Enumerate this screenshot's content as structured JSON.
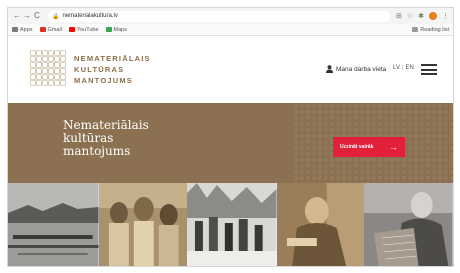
{
  "browser": {
    "url": "nematerialakultura.lv",
    "bookmarks": [
      {
        "label": "Apps",
        "color": "#7a7a7a"
      },
      {
        "label": "Gmail",
        "color": "#d93025"
      },
      {
        "label": "YouTube",
        "color": "#ff0000"
      },
      {
        "label": "Maps",
        "color": "#34a853"
      }
    ],
    "reading_list": "Reading list"
  },
  "header": {
    "logo_lines": [
      "NEMATERIĀLAIS",
      "KULTŪRAS",
      "MANTOJUMS"
    ],
    "account_label": "Mana darba vieta",
    "lang_active": "LV",
    "lang_other": "EN"
  },
  "hero": {
    "title_lines": [
      "Nemateriālais",
      "kultūras",
      "mantojums"
    ],
    "cta_label": "Uzzināt vairāk",
    "cta_arrow": "→",
    "colors": {
      "background": "#8b7151",
      "cta": "#e2203a"
    }
  },
  "photos": [
    {
      "icon": "winter-river-photo"
    },
    {
      "icon": "folk-costume-crowd-photo"
    },
    {
      "icon": "snow-procession-photo"
    },
    {
      "icon": "sepia-craftsman-photo"
    },
    {
      "icon": "kokle-player-photo"
    }
  ]
}
